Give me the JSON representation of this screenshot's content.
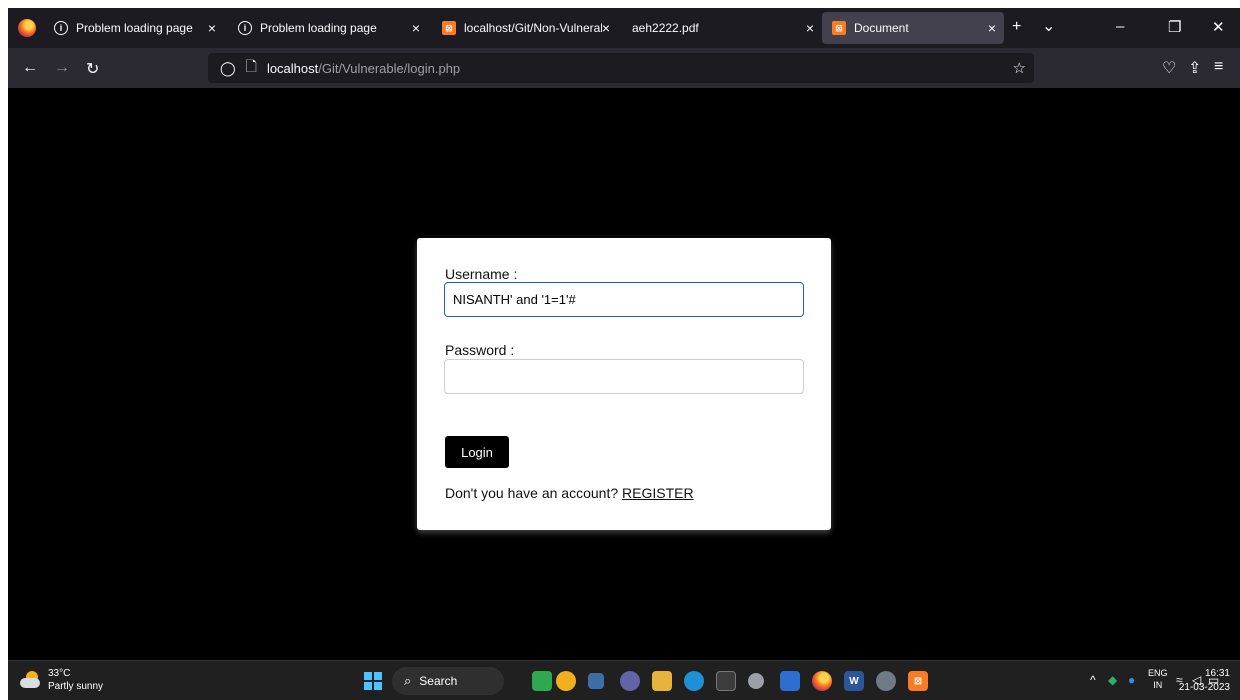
{
  "browser": {
    "tabs": [
      {
        "title": "Problem loading page",
        "icon": "info-icon",
        "active": false
      },
      {
        "title": "Problem loading page",
        "icon": "info-icon",
        "active": false
      },
      {
        "title": "localhost/Git/Non-Vulnerable/d",
        "icon": "xampp-icon",
        "active": false
      },
      {
        "title": "aeh2222.pdf",
        "icon": "none",
        "active": false
      },
      {
        "title": "Document",
        "icon": "xampp-icon",
        "active": true
      }
    ],
    "tab_close_glyph": "×",
    "new_tab_glyph": "+",
    "tab_list_glyph": "⌄",
    "url_host": "localhost",
    "url_path": "/Git/Vulnerable/login.php"
  },
  "login_form": {
    "username_label": "Username :",
    "username_value": "NISANTH' and '1=1'#",
    "password_label": "Password :",
    "password_value": "",
    "login_button": "Login",
    "register_prompt": "Don't you have an account? ",
    "register_link": "REGISTER"
  },
  "taskbar": {
    "weather_temp": "33°C",
    "weather_desc": "Partly sunny",
    "search_label": "Search",
    "lang_line1": "ENG",
    "lang_line2": "IN",
    "time": "16:31",
    "date": "21-03-2023"
  },
  "colors": {
    "tabbar_bg": "#1c1b22",
    "navbar_bg": "#2b2a33",
    "active_tab_bg": "#42414d",
    "page_bg": "#000000",
    "focus_border": "#1f5fbf",
    "taskbar_bg": "#202020"
  }
}
